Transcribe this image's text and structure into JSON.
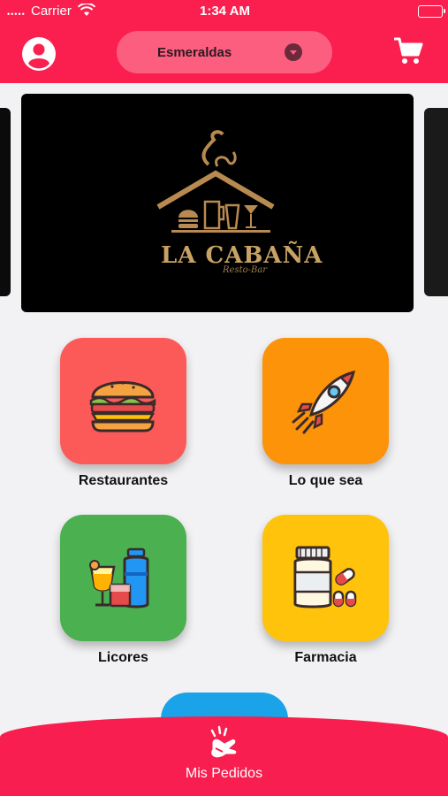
{
  "status_bar": {
    "carrier": "Carrier",
    "time": "1:34 AM"
  },
  "header": {
    "city": "Esmeraldas",
    "colors": {
      "primary": "#fa1f4f",
      "city_pill": "#fc5e80"
    },
    "icons": {
      "profile": "user-circle-icon",
      "cart": "shopping-cart-icon",
      "dropdown": "chevron-down-icon"
    }
  },
  "banner": {
    "title": "LA CABAÑA",
    "subtitle": "Resto-Bar"
  },
  "categories": [
    {
      "label": "Restaurantes",
      "color": "#fc5a58",
      "icon": "burger-icon"
    },
    {
      "label": "Lo que sea",
      "color": "#fd9308",
      "icon": "rocket-icon"
    },
    {
      "label": "Licores",
      "color": "#4bb04f",
      "icon": "drinks-icon"
    },
    {
      "label": "Farmacia",
      "color": "#fec30a",
      "icon": "pills-icon"
    }
  ],
  "bottom_bar": {
    "label": "Mis Pedidos",
    "icon": "hand-order-icon"
  }
}
